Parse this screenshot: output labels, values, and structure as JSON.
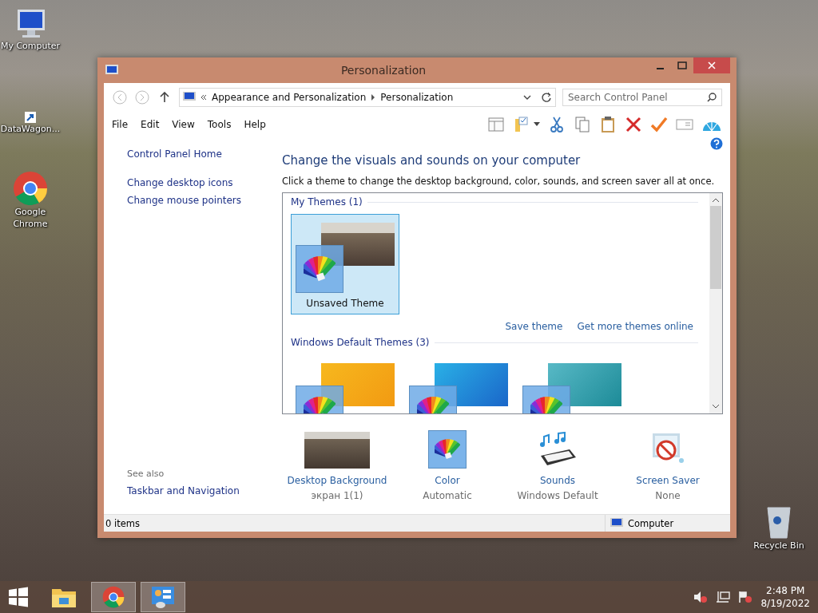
{
  "desktop_icons": [
    {
      "kind": "computer",
      "label": "My Computer"
    },
    {
      "kind": "shortcut",
      "label": "DataWagon..."
    },
    {
      "kind": "chrome",
      "label": "Google Chrome"
    }
  ],
  "recycle_bin": {
    "label": "Recycle Bin"
  },
  "window": {
    "title": "Personalization",
    "address": {
      "crumbs": [
        "Appearance and Personalization",
        "Personalization"
      ],
      "search_placeholder": "Search Control Panel"
    },
    "menu": [
      "File",
      "Edit",
      "View",
      "Tools",
      "Help"
    ],
    "sidebar": {
      "links": [
        "Control Panel Home",
        "Change desktop icons",
        "Change mouse pointers"
      ],
      "see_also_title": "See also",
      "see_also_links": [
        "Taskbar and Navigation"
      ]
    },
    "heading": "Change the visuals and sounds on your computer",
    "description": "Click a theme to change the desktop background, color, sounds, and screen saver all at once.",
    "theme_sections": [
      {
        "title": "My Themes (1)",
        "themes": [
          {
            "kind": "photo",
            "name": "Unsaved Theme",
            "selected": true
          }
        ],
        "links": [
          "Save theme",
          "Get more themes online"
        ]
      },
      {
        "title": "Windows Default Themes (3)",
        "themes": [
          {
            "kind": "yellow",
            "selected": false
          },
          {
            "kind": "blue",
            "selected": false
          },
          {
            "kind": "flower",
            "selected": false
          }
        ]
      }
    ],
    "settings": [
      {
        "kind": "background",
        "label": "Desktop Background",
        "value": "экран 1(1)"
      },
      {
        "kind": "color",
        "label": "Color",
        "value": "Automatic"
      },
      {
        "kind": "sounds",
        "label": "Sounds",
        "value": "Windows Default"
      },
      {
        "kind": "screensaver",
        "label": "Screen Saver",
        "value": "None"
      }
    ],
    "status_bar": {
      "items": "0 items",
      "location": "Computer"
    }
  },
  "taskbar": {
    "apps": [
      {
        "kind": "explorer",
        "selected": false
      },
      {
        "kind": "chrome",
        "selected": true
      },
      {
        "kind": "control-panel",
        "selected": true
      }
    ],
    "clock": {
      "time": "2:48 PM",
      "date": "8/19/2022"
    }
  }
}
